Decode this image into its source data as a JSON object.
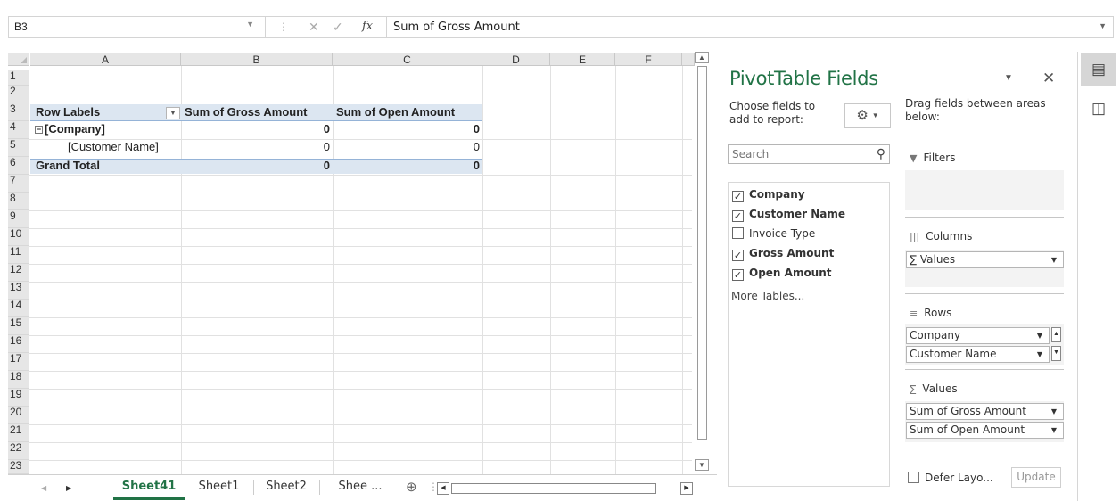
{
  "formula_bar": {
    "name_box": "B3",
    "cancel_symbol": "✕",
    "enter_symbol": "✓",
    "fx_label": "fx",
    "content": "Sum of Gross Amount"
  },
  "columns": [
    "A",
    "B",
    "C",
    "D",
    "E",
    "F"
  ],
  "rows": [
    "1",
    "2",
    "3",
    "4",
    "5",
    "6",
    "7",
    "8",
    "9",
    "10",
    "11",
    "12",
    "13",
    "14",
    "15",
    "16",
    "17",
    "18",
    "19",
    "20",
    "21",
    "22",
    "23"
  ],
  "pivot": {
    "header_row_labels": "Row Labels",
    "header_gross": "Sum of Gross Amount",
    "header_open": "Sum of Open Amount",
    "rows": [
      {
        "label": "[Company]",
        "gross": "0",
        "open": "0"
      },
      {
        "label": "[Customer Name]",
        "gross": "0",
        "open": "0"
      }
    ],
    "grand_total": {
      "label": "Grand Total",
      "gross": "0",
      "open": "0"
    }
  },
  "sheet_tabs": {
    "active": "Sheet41",
    "tabs": [
      "Sheet1",
      "Sheet2",
      "Shee ..."
    ]
  },
  "pivot_pane": {
    "title": "PivotTable Fields",
    "choose_label": "Choose fields to add to report:",
    "drag_label": "Drag fields between areas below:",
    "search_placeholder": "Search",
    "fields": [
      {
        "name": "Company",
        "checked": true
      },
      {
        "name": "Customer Name",
        "checked": true
      },
      {
        "name": "Invoice Type",
        "checked": false
      },
      {
        "name": "Gross Amount",
        "checked": true
      },
      {
        "name": "Open Amount",
        "checked": true
      }
    ],
    "more_tables": "More Tables...",
    "areas": {
      "filters_label": "Filters",
      "columns_label": "Columns",
      "rows_label": "Rows",
      "values_label": "Values",
      "columns_items": [
        "∑ Values"
      ],
      "rows_items": [
        "Company",
        "Customer Name"
      ],
      "values_items": [
        "Sum of Gross Amount",
        "Sum of Open Amount"
      ]
    },
    "defer_label": "Defer Layo...",
    "update_label": "Update"
  },
  "colors": {
    "accent_green": "#217346",
    "pivot_header_fill": "#dce6f1",
    "pivot_border": "#95b3d7"
  }
}
